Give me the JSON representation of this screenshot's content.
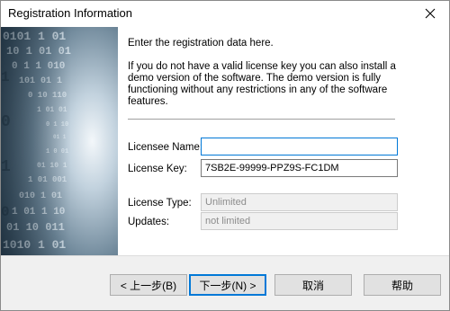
{
  "window": {
    "title": "Registration Information",
    "close_icon": "close-icon"
  },
  "banner": {
    "image": "binary-code-graphic",
    "colors": {
      "dark": "#2c4152",
      "light": "#c8d8e4"
    }
  },
  "main": {
    "intro": "Enter the registration data here.",
    "notice": "If you do not have a valid license key you can also install a demo version of the software. The demo version is fully functioning without any restrictions in any of the software features."
  },
  "form": {
    "licensee_name": {
      "label": "Licensee Name:",
      "value": ""
    },
    "license_key": {
      "label": "License Key:",
      "value": "7SB2E-99999-PPZ9S-FC1DM"
    },
    "license_type": {
      "label": "License Type:",
      "value": "Unlimited"
    },
    "updates": {
      "label": "Updates:",
      "value": "not limited"
    }
  },
  "buttons": {
    "back": "< 上一步(B)",
    "next": "下一步(N) >",
    "cancel": "取消",
    "help": "帮助"
  },
  "colors": {
    "accent": "#0078d7"
  }
}
